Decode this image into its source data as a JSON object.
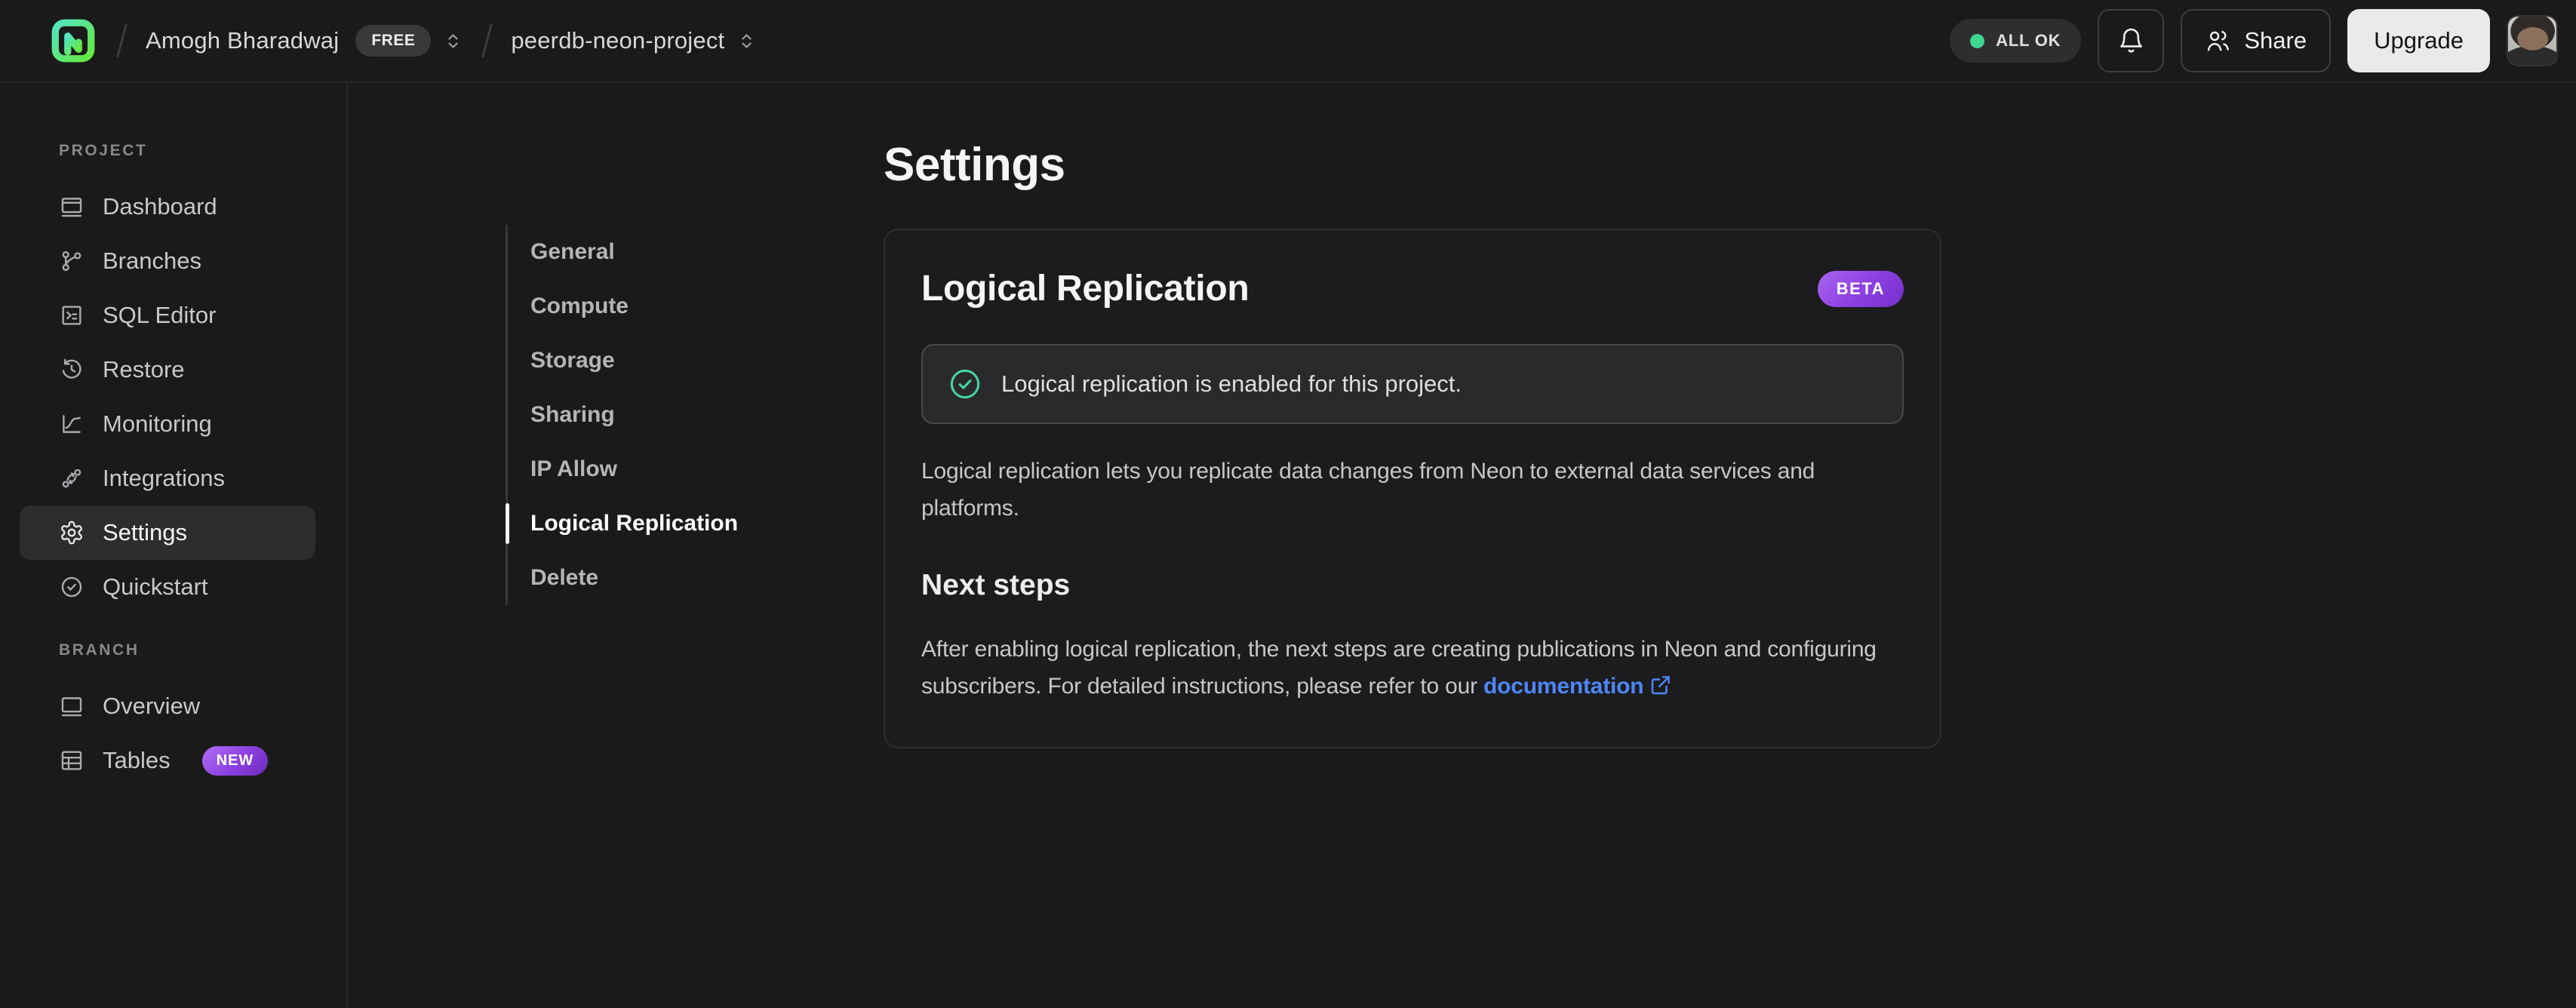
{
  "header": {
    "breadcrumb": {
      "account_name": "Amogh Bharadwaj",
      "account_plan_badge": "FREE",
      "project_name": "peerdb-neon-project"
    },
    "status_pill_label": "ALL OK",
    "share_button_label": "Share",
    "upgrade_button_label": "Upgrade"
  },
  "sidebar": {
    "sections": [
      {
        "label": "PROJECT",
        "items": [
          {
            "label": "Dashboard"
          },
          {
            "label": "Branches"
          },
          {
            "label": "SQL Editor"
          },
          {
            "label": "Restore"
          },
          {
            "label": "Monitoring"
          },
          {
            "label": "Integrations"
          },
          {
            "label": "Settings",
            "active": true
          },
          {
            "label": "Quickstart"
          }
        ]
      },
      {
        "label": "BRANCH",
        "items": [
          {
            "label": "Overview"
          },
          {
            "label": "Tables",
            "badge": "NEW"
          }
        ]
      }
    ]
  },
  "settings_nav": {
    "items": [
      {
        "label": "General"
      },
      {
        "label": "Compute"
      },
      {
        "label": "Storage"
      },
      {
        "label": "Sharing"
      },
      {
        "label": "IP Allow"
      },
      {
        "label": "Logical Replication",
        "active": true
      },
      {
        "label": "Delete"
      }
    ]
  },
  "main": {
    "page_title": "Settings",
    "card": {
      "title": "Logical Replication",
      "beta_badge": "BETA",
      "status_message": "Logical replication is enabled for this project.",
      "description": "Logical replication lets you replicate data changes from Neon to external data services and platforms.",
      "next_steps_heading": "Next steps",
      "next_steps_text": "After enabling logical replication, the next steps are creating publications in Neon and configuring subscribers. For detailed instructions, please refer to our ",
      "doc_link_label": "documentation"
    }
  },
  "colors": {
    "brand_green_start": "#53e5c1",
    "brand_green_end": "#65e83d",
    "status_dot_green": "#3fd68f",
    "success_check_green": "#46d6a0",
    "badge_purple_start": "#a965f0",
    "badge_purple_end": "#7330c8",
    "link_blue": "#4e86f7"
  }
}
